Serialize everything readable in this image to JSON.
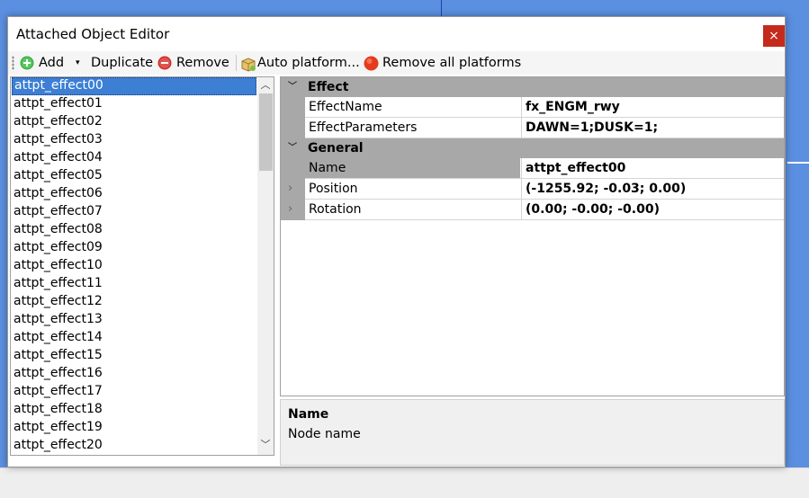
{
  "window": {
    "title": "Attached Object Editor",
    "close_icon": "×"
  },
  "toolbar": {
    "add": "Add",
    "duplicate": "Duplicate",
    "remove": "Remove",
    "auto_platform": "Auto platform...",
    "remove_all": "Remove all platforms"
  },
  "list": {
    "selected_index": 0,
    "items": [
      "attpt_effect00",
      "attpt_effect01",
      "attpt_effect02",
      "attpt_effect03",
      "attpt_effect04",
      "attpt_effect05",
      "attpt_effect06",
      "attpt_effect07",
      "attpt_effect08",
      "attpt_effect09",
      "attpt_effect10",
      "attpt_effect11",
      "attpt_effect12",
      "attpt_effect13",
      "attpt_effect14",
      "attpt_effect15",
      "attpt_effect16",
      "attpt_effect17",
      "attpt_effect18",
      "attpt_effect19",
      "attpt_effect20"
    ]
  },
  "properties": {
    "effect": {
      "label": "Effect",
      "rows": [
        {
          "name": "EffectName",
          "value": "fx_ENGM_rwy"
        },
        {
          "name": "EffectParameters",
          "value": "DAWN=1;DUSK=1;"
        }
      ]
    },
    "general": {
      "label": "General",
      "rows": [
        {
          "name": "Name",
          "value": "attpt_effect00"
        },
        {
          "name": "Position",
          "value": "(-1255.92; -0.03; 0.00)"
        },
        {
          "name": "Rotation",
          "value": "(0.00; -0.00; -0.00)"
        }
      ]
    }
  },
  "help": {
    "title": "Name",
    "description": "Node name"
  },
  "colors": {
    "selection": "#3c7fd5",
    "close": "#c42b1c",
    "category": "#a8a8a8"
  }
}
